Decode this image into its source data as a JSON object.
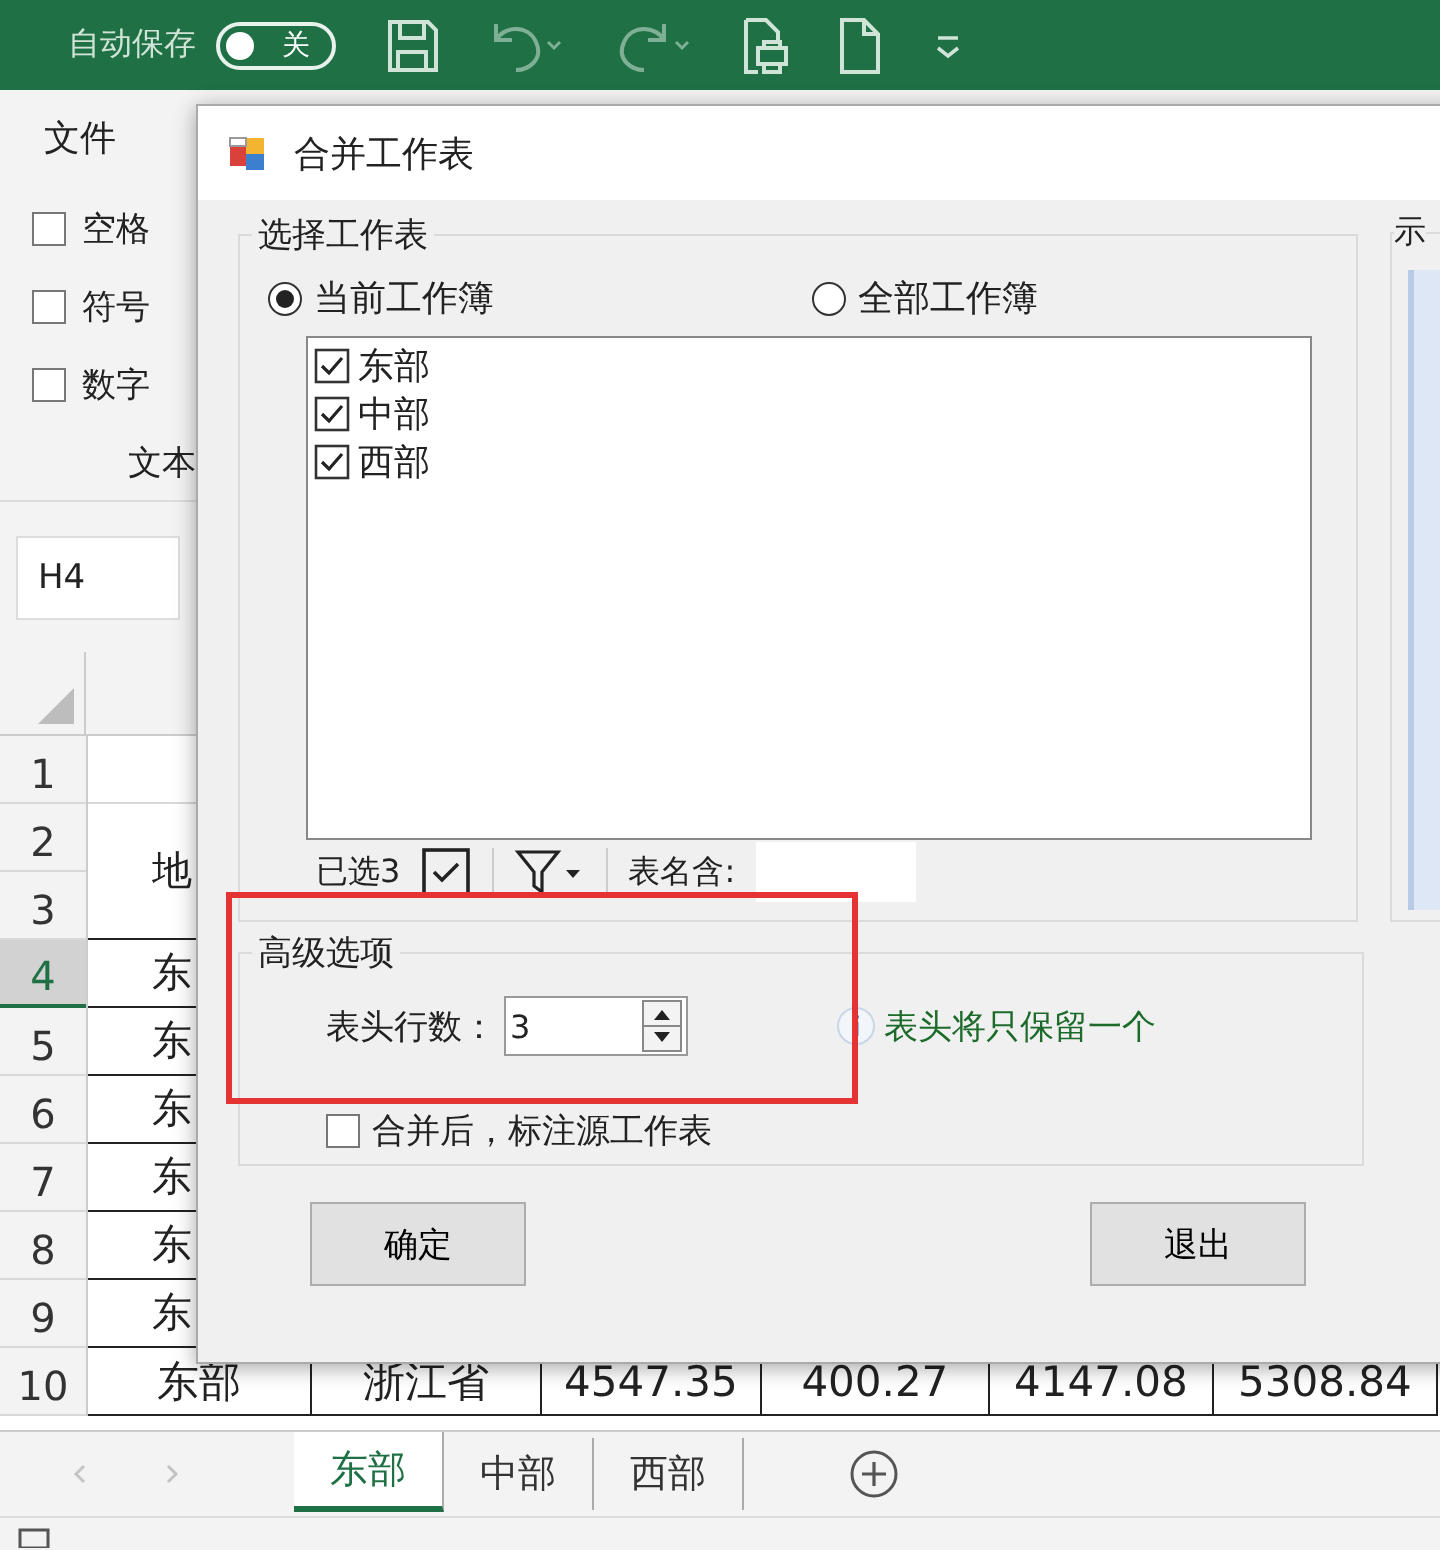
{
  "app": {
    "autosave_label": "自动保存",
    "autosave_toggle": {
      "label": "关",
      "on": false
    }
  },
  "ribbon": {
    "file_tab": "文件",
    "options": [
      {
        "label": "空格",
        "checked": false
      },
      {
        "label": "符号",
        "checked": false
      },
      {
        "label": "数字",
        "checked": false
      }
    ],
    "group_label": "文本"
  },
  "name_box": "H4",
  "sheet": {
    "rows": [
      {
        "number": "1",
        "selected": false
      },
      {
        "number": "2",
        "selected": false
      },
      {
        "number": "3",
        "selected": false
      },
      {
        "number": "4",
        "selected": true
      },
      {
        "number": "5",
        "selected": false
      },
      {
        "number": "6",
        "selected": false
      },
      {
        "number": "7",
        "selected": false
      },
      {
        "number": "8",
        "selected": false
      },
      {
        "number": "9",
        "selected": false
      },
      {
        "number": "10",
        "selected": false
      }
    ],
    "column_a": [
      {
        "kind": "merged",
        "text": "地"
      },
      {
        "kind": "single",
        "text": "东"
      },
      {
        "kind": "single",
        "text": "东"
      },
      {
        "kind": "single",
        "text": "东"
      },
      {
        "kind": "single",
        "text": "东"
      },
      {
        "kind": "single",
        "text": "东"
      },
      {
        "kind": "single",
        "text": "东"
      }
    ],
    "last_row": [
      "东部",
      "浙江省",
      "4547.35",
      "400.27",
      "4147.08",
      "5308.84"
    ]
  },
  "sheet_tabs": [
    {
      "label": "东部",
      "selected": true
    },
    {
      "label": "中部",
      "selected": false
    },
    {
      "label": "西部",
      "selected": false
    }
  ],
  "dialog": {
    "title": "合并工作表",
    "sheet_group": {
      "title": "选择工作表",
      "scope": [
        {
          "label": "当前工作簿",
          "selected": true
        },
        {
          "label": "全部工作簿",
          "selected": false
        }
      ],
      "sheets": [
        {
          "label": "东部",
          "checked": true
        },
        {
          "label": "中部",
          "checked": true
        },
        {
          "label": "西部",
          "checked": true
        }
      ],
      "selected_count": "已选3",
      "name_filter_label": "表名含:"
    },
    "preview_group": {
      "title": "示"
    },
    "advanced": {
      "title": "高级选项",
      "header_rows_label": "表头行数：",
      "header_rows_value": "3",
      "hint": "表头将只保留一个",
      "mark_source": {
        "label": "合并后，标注源工作表",
        "checked": false
      }
    },
    "buttons": [
      "确定",
      "退出"
    ]
  }
}
